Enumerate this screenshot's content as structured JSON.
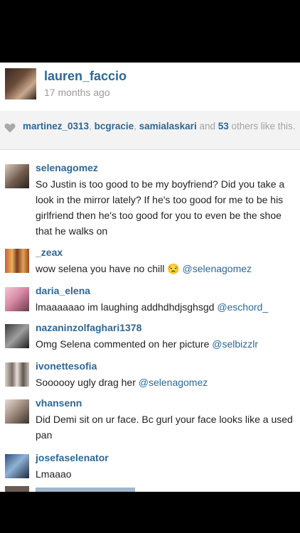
{
  "post": {
    "username": "lauren_faccio",
    "time_ago": "17 months ago"
  },
  "likes": {
    "user1": "martinez_0313",
    "sep1": ", ",
    "user2": "bcgracie",
    "sep2": ", ",
    "user3": "samialaskari",
    "and_text": " and ",
    "others_count": "53",
    "others_text": " others like this."
  },
  "comments": [
    {
      "username": "selenagomez",
      "text": "So Justin is too good to be my boyfriend? Did you take a look in the mirror lately? If he's too good for me to be his girlfriend then he's too good for you to even be the shoe that he walks on",
      "mention": ""
    },
    {
      "username": "_zeax",
      "text": "wow selena you have no chill 😒 ",
      "mention": "@selenagomez"
    },
    {
      "username": "daria_elena",
      "text": "lmaaaaaao im laughing addhdhdjsghsgd ",
      "mention": "@eschord_"
    },
    {
      "username": "nazaninzolfaghari1378",
      "text": "Omg Selena commented on her picture ",
      "mention": "@selbizzlr"
    },
    {
      "username": "ivonettesofia",
      "text": "Soooooy ugly drag her ",
      "mention": "@selenagomez"
    },
    {
      "username": "vhansenn",
      "text": "Did Demi sit on ur face. Bc gurl your face looks like a used pan",
      "mention": ""
    },
    {
      "username": "josefaselenator",
      "text": "Lmaaao",
      "mention": ""
    }
  ],
  "colors": {
    "username": "#2e6794",
    "text": "#222222",
    "muted": "#9b9b9b",
    "likes_bg": "#f3f3f3"
  },
  "icons": {
    "heart": "heart-icon"
  }
}
